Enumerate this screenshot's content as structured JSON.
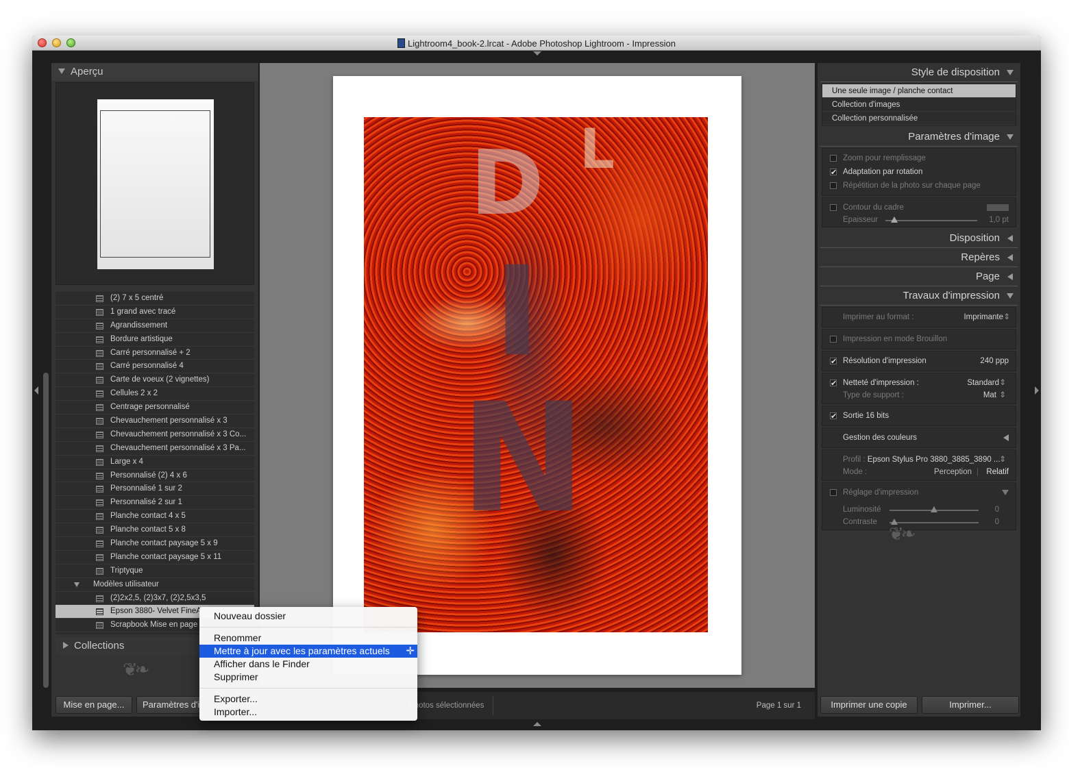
{
  "window": {
    "title": "Lightroom4_book-2.lrcat - Adobe Photoshop Lightroom - Impression"
  },
  "left_panel": {
    "preview_title": "Aperçu",
    "templates": [
      "(2) 7 x 5 centré",
      "1 grand avec tracé",
      "Agrandissement",
      "Bordure artistique",
      "Carré personnalisé + 2",
      "Carré personnalisé 4",
      "Carte de voeux (2 vignettes)",
      "Cellules 2 x 2",
      "Centrage personnalisé",
      "Chevauchement personnalisé x 3",
      "Chevauchement personnalisé x 3 Co...",
      "Chevauchement personnalisé x 3 Pa...",
      "Large x 4",
      "Personnalisé (2) 4 x 6",
      "Personnalisé 1 sur 2",
      "Personnalisé 2 sur 1",
      "Planche contact 4 x 5",
      "Planche contact 5 x 8",
      "Planche contact paysage 5 x 9",
      "Planche contact paysage 5 x 11",
      "Triptyque"
    ],
    "user_folder": "Modèles utilisateur",
    "user_templates": [
      "(2)2x2,5, (2)3x7, (2)2,5x3,5",
      "Epson 3880- Velvet FineA",
      "Scrapbook Mise en page"
    ],
    "collections_title": "Collections",
    "page_setup_button": "Mise en page...",
    "print_settings_button": "Paramètres d'i"
  },
  "center": {
    "bottom_label": "Photos sélectionnées",
    "page_count": "Page 1 sur 1"
  },
  "context_menu": {
    "items": [
      "Nouveau dossier",
      "Renommer",
      "Mettre à jour avec les paramètres actuels",
      "Afficher dans le Finder",
      "Supprimer",
      "Exporter...",
      "Importer..."
    ]
  },
  "right_panel": {
    "layout_style": {
      "title": "Style de disposition",
      "options": [
        "Une seule image / planche contact",
        "Collection d'images",
        "Collection personnalisée"
      ]
    },
    "image_settings": {
      "title": "Paramètres d'image",
      "zoom_fill": "Zoom pour remplissage",
      "rotate_fit": "Adaptation par rotation",
      "repeat_photo": "Répétition de la photo sur chaque page",
      "stroke_border": "Contour du cadre",
      "thickness_label": "Epaisseur",
      "thickness_value": "1,0 pt"
    },
    "layout": {
      "title": "Disposition"
    },
    "guides": {
      "title": "Repères"
    },
    "page": {
      "title": "Page"
    },
    "print_job": {
      "title": "Travaux d'impression",
      "print_to_label": "Imprimer au format :",
      "print_to_value": "Imprimante",
      "draft_mode": "Impression en mode Brouillon",
      "resolution_label": "Résolution d'impression",
      "resolution_value": "240 ppp",
      "sharpening_label": "Netteté d'impression :",
      "sharpening_value": "Standard",
      "media_label": "Type de support :",
      "media_value": "Mat",
      "bits_16": "Sortie 16 bits",
      "color_management": "Gestion des couleurs",
      "profile_label": "Profil :",
      "profile_value": "Epson Stylus Pro 3880_3885_3890 ...",
      "mode_label": "Mode :",
      "mode_perception": "Perception",
      "mode_relative": "Relatif",
      "print_adjust": "Réglage d'impression",
      "brightness_label": "Luminosité",
      "brightness_value": "0",
      "contrast_label": "Contraste",
      "contrast_value": "0"
    },
    "print_one_button": "Imprimer une copie",
    "print_button": "Imprimer..."
  }
}
